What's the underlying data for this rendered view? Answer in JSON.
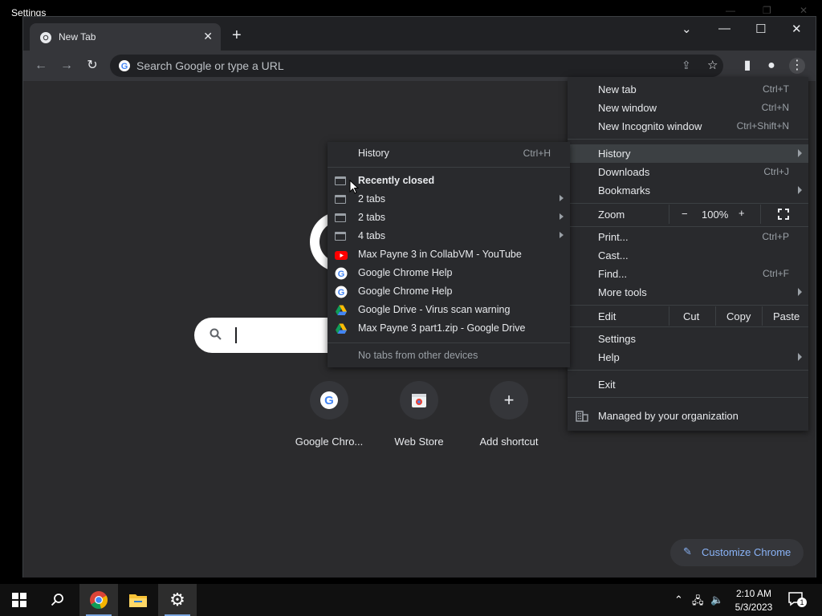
{
  "background_window": {
    "title": "Settings"
  },
  "tab": {
    "title": "New Tab"
  },
  "omnibox": {
    "placeholder": "Search Google or type a URL"
  },
  "menu": {
    "new_tab": {
      "label": "New tab",
      "shortcut": "Ctrl+T"
    },
    "new_window": {
      "label": "New window",
      "shortcut": "Ctrl+N"
    },
    "new_incognito": {
      "label": "New Incognito window",
      "shortcut": "Ctrl+Shift+N"
    },
    "history": {
      "label": "History"
    },
    "downloads": {
      "label": "Downloads",
      "shortcut": "Ctrl+J"
    },
    "bookmarks": {
      "label": "Bookmarks"
    },
    "zoom": {
      "label": "Zoom",
      "minus": "−",
      "value": "100%",
      "plus": "+"
    },
    "print": {
      "label": "Print...",
      "shortcut": "Ctrl+P"
    },
    "cast": {
      "label": "Cast..."
    },
    "find": {
      "label": "Find...",
      "shortcut": "Ctrl+F"
    },
    "more_tools": {
      "label": "More tools"
    },
    "edit": {
      "label": "Edit",
      "cut": "Cut",
      "copy": "Copy",
      "paste": "Paste"
    },
    "settings": {
      "label": "Settings"
    },
    "help": {
      "label": "Help"
    },
    "exit": {
      "label": "Exit"
    },
    "managed": {
      "label": "Managed by your organization"
    }
  },
  "history_submenu": {
    "history": {
      "label": "History",
      "shortcut": "Ctrl+H"
    },
    "recently_closed": "Recently closed",
    "items": [
      {
        "label": "2 tabs",
        "icon": "tab-group-icon",
        "submenu": true
      },
      {
        "label": "2 tabs",
        "icon": "tab-group-icon",
        "submenu": true
      },
      {
        "label": "4 tabs",
        "icon": "tab-group-icon",
        "submenu": true
      },
      {
        "label": "Max Payne 3 in CollabVM - YouTube",
        "icon": "youtube-icon"
      },
      {
        "label": "Google Chrome Help",
        "icon": "google-icon"
      },
      {
        "label": "Google Chrome Help",
        "icon": "google-icon"
      },
      {
        "label": "Google Drive - Virus scan warning",
        "icon": "google-drive-icon"
      },
      {
        "label": "Max Payne 3 part1.zip - Google Drive",
        "icon": "google-drive-icon"
      }
    ],
    "no_tabs": "No tabs from other devices"
  },
  "shortcuts": [
    {
      "label": "Google Chro...",
      "icon": "google-icon"
    },
    {
      "label": "Web Store",
      "icon": "web-store-icon"
    },
    {
      "label": "Add shortcut",
      "icon": "plus-icon"
    }
  ],
  "customize": {
    "label": "Customize Chrome"
  },
  "taskbar": {
    "time": "2:10 AM",
    "date": "5/3/2023",
    "notification_count": "1"
  },
  "colors": {
    "accent": "#8ab4f8",
    "menu_bg": "#292a2d",
    "content_bg": "#2b2b2d"
  }
}
